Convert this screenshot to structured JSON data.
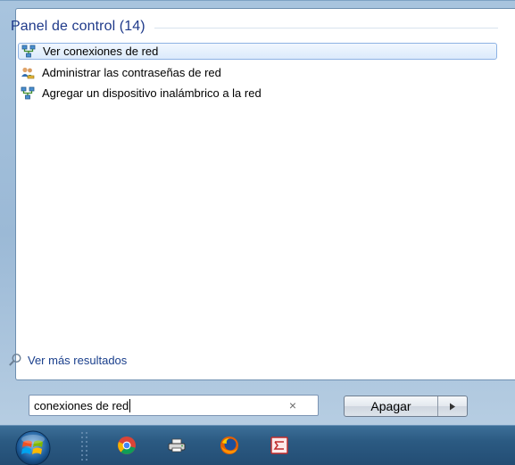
{
  "panel": {
    "group_title": "Panel de control (14)",
    "results": [
      {
        "label": "Ver conexiones de red",
        "icon": "network-connections-icon",
        "selected": true
      },
      {
        "label": "Administrar las contraseñas de red",
        "icon": "users-key-icon",
        "selected": false
      },
      {
        "label": "Agregar un dispositivo inalámbrico a la red",
        "icon": "network-connections-icon",
        "selected": false
      }
    ],
    "more_results_label": "Ver más resultados"
  },
  "search": {
    "value": "conexiones de red",
    "clear_glyph": "×"
  },
  "shutdown": {
    "label": "Apagar"
  },
  "taskbar": {
    "items": [
      "start-orb",
      "chrome-icon",
      "printer-icon",
      "firefox-icon",
      "app-icon"
    ]
  },
  "colors": {
    "group_title": "#1f3a8a",
    "link": "#1a3f8c",
    "selection_border": "#8db2e3",
    "taskbar": "#2b5a82"
  }
}
